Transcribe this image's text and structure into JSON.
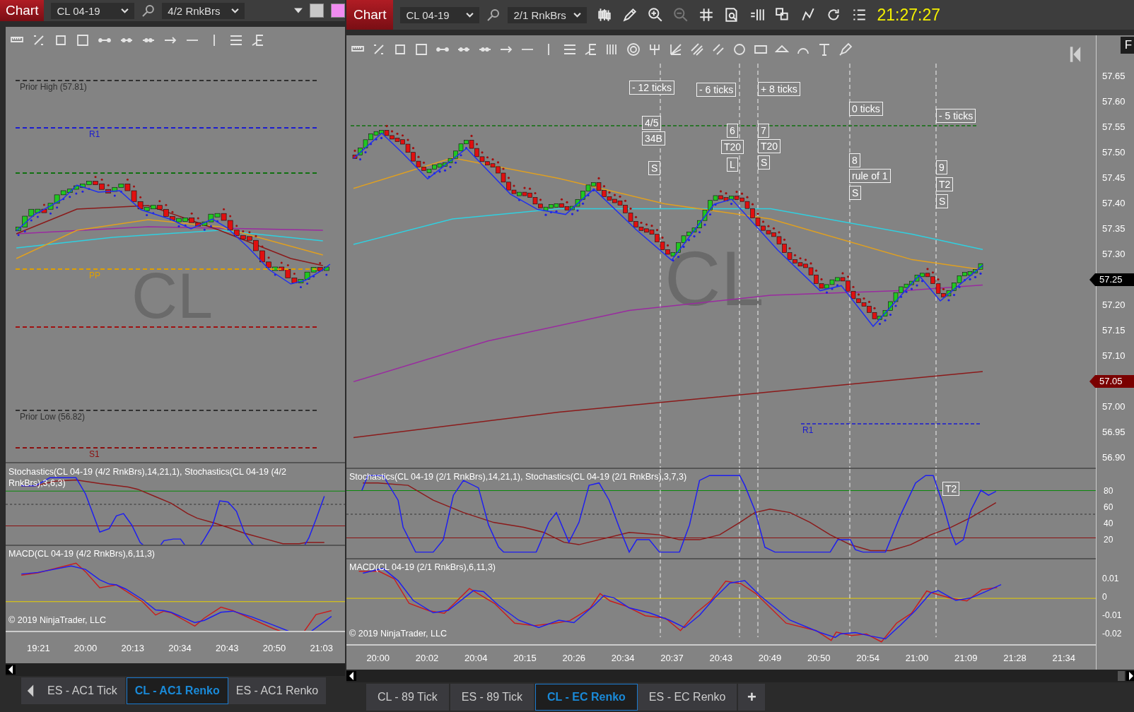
{
  "left": {
    "title": "Chart",
    "instrument": "CL 04-19",
    "bar_type": "4/2 RnkBrs",
    "swatches": [
      {
        "color": "#c8c8c8"
      },
      {
        "color": "#f08cf0"
      }
    ],
    "chart_watermark": "CL",
    "levels": [
      {
        "text": "Prior High (57.81)",
        "color": "#303030"
      },
      {
        "text": "R1",
        "color": "#1c1cd0"
      },
      {
        "color": "#107010"
      },
      {
        "text": "PP",
        "color": "#e0a000"
      },
      {
        "color": "#a01010"
      },
      {
        "text": "Prior Low (56.82)",
        "color": "#303030"
      },
      {
        "text": "S1",
        "color": "#8b1010"
      }
    ],
    "stochastics_label": "Stochastics(CL 04-19 (4/2 RnkBrs),14,21,1), Stochastics(CL 04-19 (4/2 RnkBrs),3,6,3)",
    "macd_label": "MACD(CL 04-19 (4/2 RnkBrs),6,11,3)",
    "copyright": "© 2019 NinjaTrader, LLC",
    "time_labels": [
      "19:21",
      "20:00",
      "20:13",
      "20:34",
      "20:43",
      "20:50",
      "21:03"
    ],
    "tabs": [
      {
        "label": "ES - AC1 Tick",
        "selected": false
      },
      {
        "label": "CL - AC1 Renko",
        "selected": true
      },
      {
        "label": "ES - AC1 Renko",
        "selected": false
      }
    ]
  },
  "right": {
    "title": "Chart",
    "instrument": "CL 04-19",
    "bar_type": "2/1 RnkBrs",
    "clock": "21:27:27",
    "corner_button": "F",
    "chart_watermark": "CL",
    "annotations": [
      {
        "text": "- 12 ticks"
      },
      {
        "text": "4/5"
      },
      {
        "text": "34B"
      },
      {
        "text": "S"
      },
      {
        "text": "- 6 ticks"
      },
      {
        "text": "6"
      },
      {
        "text": "T20"
      },
      {
        "text": "L"
      },
      {
        "text": "+ 8 ticks"
      },
      {
        "text": "7"
      },
      {
        "text": "T20"
      },
      {
        "text": "S"
      },
      {
        "text": "0 ticks"
      },
      {
        "text": "8"
      },
      {
        "text": "rule of 1"
      },
      {
        "text": "S"
      },
      {
        "text": "- 5 ticks"
      },
      {
        "text": "9"
      },
      {
        "text": "T2"
      },
      {
        "text": "S"
      }
    ],
    "level_label": "R1",
    "price_axis": [
      {
        "text": "57.65",
        "kind": "tick"
      },
      {
        "text": "57.60",
        "kind": "tick"
      },
      {
        "text": "57.55",
        "kind": "tick"
      },
      {
        "text": "57.50",
        "kind": "tick"
      },
      {
        "text": "57.45",
        "kind": "tick"
      },
      {
        "text": "57.40",
        "kind": "tick"
      },
      {
        "text": "57.35",
        "kind": "tick"
      },
      {
        "text": "57.30",
        "kind": "tick"
      },
      {
        "text": "57.25",
        "kind": "tag",
        "color": "#000000"
      },
      {
        "text": "57.20",
        "kind": "tick"
      },
      {
        "text": "57.15",
        "kind": "tick"
      },
      {
        "text": "57.10",
        "kind": "tick"
      },
      {
        "text": "57.05",
        "kind": "tag",
        "color": "#7a0000"
      },
      {
        "text": "57.00",
        "kind": "tick"
      },
      {
        "text": "56.95",
        "kind": "tick"
      },
      {
        "text": "56.90",
        "kind": "tick"
      }
    ],
    "stochastics_label": "Stochastics(CL 04-19 (2/1 RnkBrs),14,21,1), Stochastics(CL 04-19 (2/1 RnkBrs),3,7,3)",
    "stochastics_marker": "T2",
    "stochastics_axis": [
      "80",
      "60",
      "40",
      "20"
    ],
    "macd_label": "MACD(CL 04-19 (2/1 RnkBrs),6,11,3)",
    "macd_axis": [
      "0.01",
      "0",
      "-0.01",
      "-0.02"
    ],
    "copyright": "© 2019 NinjaTrader, LLC",
    "time_labels": [
      "20:00",
      "20:02",
      "20:04",
      "20:15",
      "20:26",
      "20:34",
      "20:37",
      "20:43",
      "20:49",
      "20:50",
      "20:54",
      "21:00",
      "21:09",
      "21:28",
      "21:34"
    ],
    "tabs": [
      {
        "label": "CL - 89 Tick",
        "selected": false
      },
      {
        "label": "ES - 89 Tick",
        "selected": false
      },
      {
        "label": "CL - EC Renko",
        "selected": true
      },
      {
        "label": "ES - EC Renko",
        "selected": false
      }
    ],
    "add_tab": "+"
  }
}
